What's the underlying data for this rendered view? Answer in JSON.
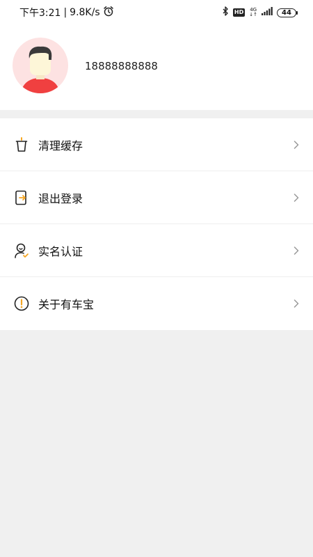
{
  "status_bar": {
    "time": "下午3:21",
    "separator": "|",
    "speed": "9.8K/s",
    "network_type": "4G",
    "network_sub": "↓↑",
    "hd_label": "HD",
    "battery": "44",
    "icons": [
      "alarm-icon",
      "bluetooth-icon",
      "hd-icon",
      "signal-icon",
      "battery-icon"
    ]
  },
  "profile": {
    "phone": "18888888888"
  },
  "menu": {
    "items": [
      {
        "label": "清理缓存",
        "icon": "trash-icon"
      },
      {
        "label": "退出登录",
        "icon": "logout-icon"
      },
      {
        "label": "实名认证",
        "icon": "verify-user-icon"
      },
      {
        "label": "关于有车宝",
        "icon": "info-icon"
      }
    ]
  },
  "colors": {
    "accent": "#f5a623",
    "avatar_bg": "#fde2e2",
    "shirt": "#f04040",
    "page_bg": "#f0f0f0"
  }
}
